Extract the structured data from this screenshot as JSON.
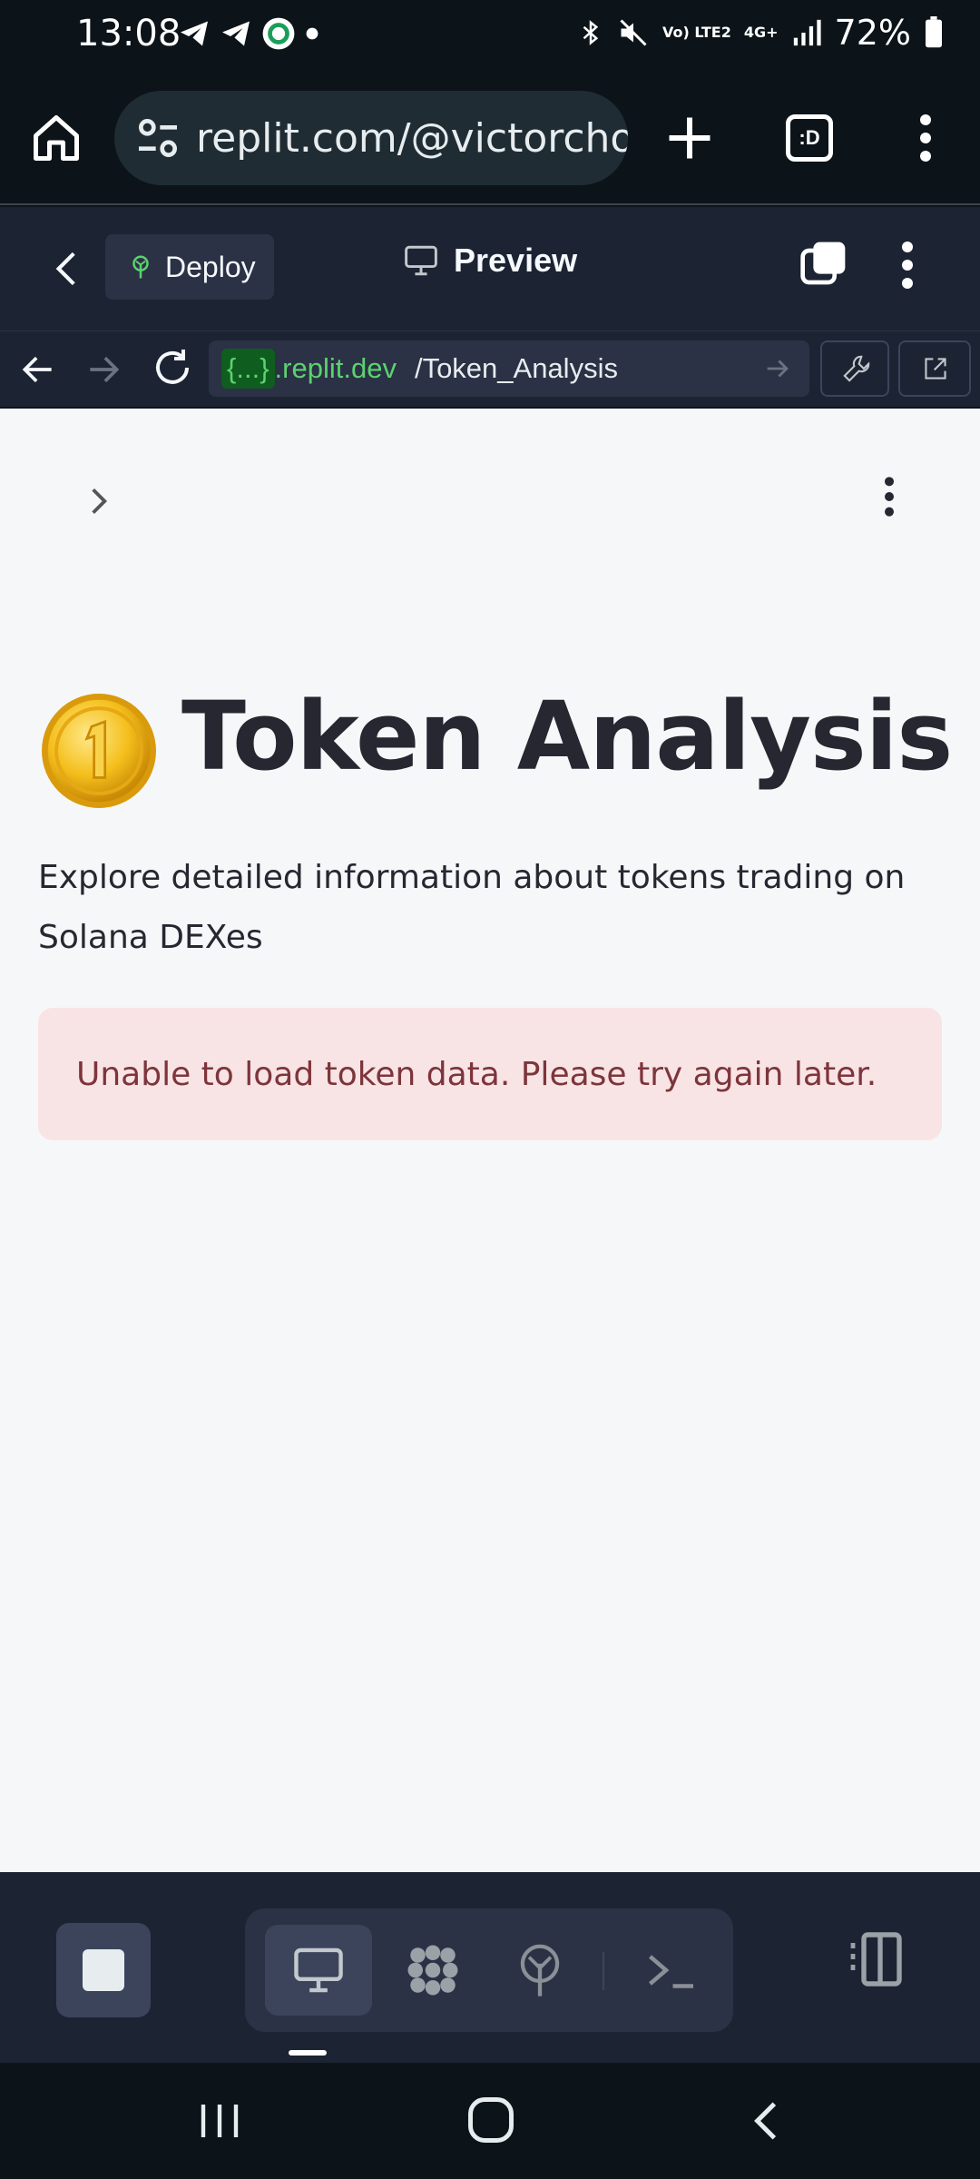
{
  "status_bar": {
    "time": "13:08",
    "battery": "72%",
    "network_top": "Vo) LTE2",
    "network_gen": "4G+"
  },
  "browser": {
    "url": "replit.com/@victorchoisunny/",
    "tabs_label": ":D"
  },
  "replit_header": {
    "deploy_label": "Deploy",
    "preview_label": "Preview"
  },
  "replit_address": {
    "badge": "{...}",
    "domain": ".replit.dev",
    "path": "/Token_Analysis"
  },
  "app": {
    "title": "Token Analysis",
    "title_icon": "coin-emoji",
    "description": "Explore detailed information about tokens trading on Solana DEXes",
    "error_message": "Unable to load token data. Please try again later."
  },
  "workspace_bar": {
    "tools": [
      "webview-icon",
      "agent-icon",
      "deployments-icon",
      "shell-icon"
    ],
    "active_tool": "webview-icon"
  },
  "colors": {
    "app_background": "#f6f7f9",
    "replit_chrome": "#1c2333",
    "error_background": "#f9e4e5",
    "error_text": "#7d353b",
    "domain_green": "#5bd26f"
  }
}
